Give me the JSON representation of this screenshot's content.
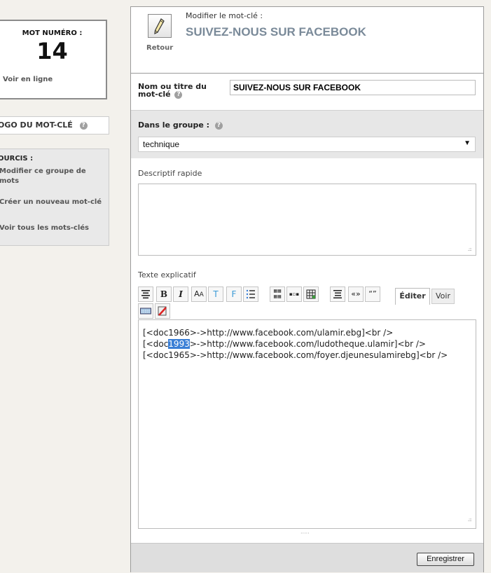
{
  "sidebar": {
    "numero_label": "MOT NUMÉRO :",
    "numero": "14",
    "voir_en_ligne": "Voir en ligne",
    "logo_label": "OGO DU MOT-CLÉ",
    "raccourcis_title": "OURCIS :",
    "links": [
      "Modifier ce groupe de mots",
      "Créer un nouveau mot-clé",
      "Voir tous les mots-clés"
    ]
  },
  "header": {
    "back_label": "Retour",
    "subtitle": "Modifier le mot-clé :",
    "title": "SUIVEZ-NOUS SUR FACEBOOK"
  },
  "form": {
    "nom_label_line1": "Nom ou titre du",
    "nom_label_line2": "mot-clé",
    "nom_value": "SUIVEZ-NOUS SUR FACEBOOK",
    "groupe_label": "Dans le groupe :",
    "groupe_value": "technique",
    "descriptif_label": "Descriptif rapide",
    "texte_label": "Texte explicatif",
    "tab_editer": "Éditer",
    "tab_voir": "Voir",
    "editor_lines": [
      {
        "pre": "[<doc1966>->http://www.facebook.com/ulamir.ebg]<br />",
        "sel": "",
        "post": ""
      },
      {
        "pre": "[<doc",
        "sel": "1993",
        "post": ">->http://www.facebook.com/ludotheque.ulamir]<br />"
      },
      {
        "pre": "[<doc1965>->http://www.facebook.com/foyer.djeunesulamirebg]<br />",
        "sel": "",
        "post": ""
      }
    ],
    "save_label": "Enregistrer"
  },
  "help_glyph": "?",
  "colors": {
    "title": "#7a8a99",
    "selection": "#3a7fd6"
  }
}
